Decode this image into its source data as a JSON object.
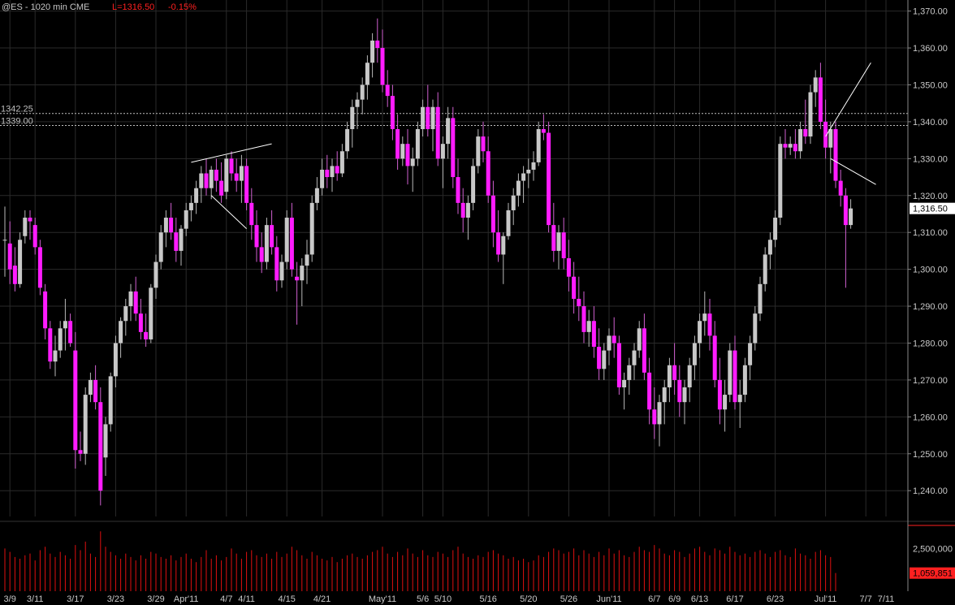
{
  "header": {
    "symbol": "@ES - 1020 min  CME",
    "last": "L=1316.50",
    "change": "-0.15%"
  },
  "colors": {
    "background": "#000000",
    "up": "#c8c8c8",
    "down": "#ff1cff",
    "wick": "#d060d0",
    "grid": "#2a2a2a",
    "axis_text": "#c8c8c8",
    "header_symbol": "#c8c8c8",
    "header_change": "#ff2020",
    "current_price_box": "#ffffff",
    "volume_marker": "#ff2020"
  },
  "chart_data": [
    {
      "type": "candlestick",
      "title": "@ES - 1020 min  CME",
      "ylim": [
        1233,
        1373
      ],
      "y_ticks": [
        "1,240.00",
        "1,250.00",
        "1,260.00",
        "1,270.00",
        "1,280.00",
        "1,290.00",
        "1,300.00",
        "1,310.00",
        "1,320.00",
        "1,330.00",
        "1,340.00",
        "1,350.00",
        "1,360.00",
        "1,370.00"
      ],
      "x_labels": [
        "3/9",
        "3/11",
        "3/17",
        "3/23",
        "3/29",
        "Apr'11",
        "4/7",
        "4/11",
        "4/15",
        "4/21",
        "May'11",
        "5/6",
        "5/10",
        "5/16",
        "5/20",
        "5/26",
        "Jun'11",
        "6/7",
        "6/9",
        "6/13",
        "6/17",
        "6/23",
        "Jul'11",
        "7/7",
        "7/11"
      ],
      "x_label_index": [
        1,
        6,
        14,
        22,
        30,
        36,
        44,
        48,
        56,
        63,
        75,
        83,
        87,
        96,
        104,
        112,
        120,
        129,
        133,
        138,
        145,
        153,
        163,
        171,
        175
      ],
      "reference_lines": [
        {
          "value": 1342.25,
          "label": "1342.25"
        },
        {
          "value": 1339.0,
          "label": "1339.00"
        }
      ],
      "current_price": {
        "value": 1316.5,
        "label": "1,316.50"
      },
      "trendlines": [
        {
          "from": [
            37,
            1329
          ],
          "to": [
            53,
            1334
          ]
        },
        {
          "from": [
            41,
            1320
          ],
          "to": [
            48,
            1311
          ]
        },
        {
          "from": [
            163,
            1336
          ],
          "to": [
            172,
            1356
          ]
        },
        {
          "from": [
            164,
            1330
          ],
          "to": [
            173,
            1323
          ]
        }
      ],
      "candles": [
        [
          1308,
          1317,
          1298,
          1308
        ],
        [
          1307,
          1313,
          1296,
          1300
        ],
        [
          1301,
          1306,
          1294,
          1296
        ],
        [
          1296,
          1310,
          1295,
          1308
        ],
        [
          1309,
          1316,
          1307,
          1314
        ],
        [
          1314,
          1316,
          1308,
          1313
        ],
        [
          1312,
          1314,
          1304,
          1306
        ],
        [
          1306,
          1308,
          1293,
          1295
        ],
        [
          1294,
          1296,
          1281,
          1284
        ],
        [
          1284,
          1286,
          1273,
          1275
        ],
        [
          1275,
          1282,
          1271,
          1278
        ],
        [
          1278,
          1286,
          1276,
          1284
        ],
        [
          1284,
          1292,
          1278,
          1286
        ],
        [
          1286,
          1288,
          1279,
          1280
        ],
        [
          1278,
          1283,
          1246,
          1251
        ],
        [
          1251,
          1256,
          1248,
          1250
        ],
        [
          1250,
          1268,
          1247,
          1266
        ],
        [
          1266,
          1272,
          1264,
          1270
        ],
        [
          1270,
          1274,
          1262,
          1264
        ],
        [
          1264,
          1268,
          1236,
          1240
        ],
        [
          1249,
          1260,
          1244,
          1258
        ],
        [
          1258,
          1272,
          1256,
          1271
        ],
        [
          1271,
          1282,
          1268,
          1280
        ],
        [
          1280,
          1287,
          1276,
          1286
        ],
        [
          1286,
          1292,
          1282,
          1290
        ],
        [
          1290,
          1296,
          1286,
          1294
        ],
        [
          1294,
          1298,
          1286,
          1288
        ],
        [
          1288,
          1292,
          1281,
          1283
        ],
        [
          1283,
          1288,
          1279,
          1281
        ],
        [
          1281,
          1296,
          1280,
          1295
        ],
        [
          1295,
          1304,
          1292,
          1302
        ],
        [
          1302,
          1312,
          1300,
          1310
        ],
        [
          1310,
          1316,
          1306,
          1314
        ],
        [
          1314,
          1318,
          1308,
          1310
        ],
        [
          1310,
          1314,
          1302,
          1305
        ],
        [
          1305,
          1312,
          1301,
          1311
        ],
        [
          1311,
          1318,
          1309,
          1316
        ],
        [
          1316,
          1320,
          1313,
          1318
        ],
        [
          1318,
          1324,
          1315,
          1322
        ],
        [
          1322,
          1328,
          1318,
          1326
        ],
        [
          1326,
          1330,
          1320,
          1322
        ],
        [
          1322,
          1328,
          1319,
          1327
        ],
        [
          1327,
          1330,
          1321,
          1324
        ],
        [
          1324,
          1329,
          1318,
          1320
        ],
        [
          1321,
          1331,
          1319,
          1330
        ],
        [
          1330,
          1332,
          1324,
          1326
        ],
        [
          1326,
          1330,
          1321,
          1324
        ],
        [
          1324,
          1331,
          1318,
          1328
        ],
        [
          1328,
          1330,
          1316,
          1318
        ],
        [
          1318,
          1322,
          1308,
          1312
        ],
        [
          1312,
          1316,
          1302,
          1306
        ],
        [
          1306,
          1310,
          1299,
          1302
        ],
        [
          1302,
          1314,
          1300,
          1312
        ],
        [
          1312,
          1316,
          1304,
          1306
        ],
        [
          1306,
          1309,
          1294,
          1297
        ],
        [
          1297,
          1304,
          1295,
          1302
        ],
        [
          1302,
          1316,
          1300,
          1314
        ],
        [
          1314,
          1318,
          1298,
          1300
        ],
        [
          1298,
          1302,
          1285,
          1297
        ],
        [
          1297,
          1303,
          1290,
          1301
        ],
        [
          1301,
          1308,
          1296,
          1304
        ],
        [
          1304,
          1320,
          1302,
          1318
        ],
        [
          1318,
          1325,
          1316,
          1322
        ],
        [
          1322,
          1330,
          1320,
          1327
        ],
        [
          1327,
          1331,
          1322,
          1325
        ],
        [
          1325,
          1330,
          1321,
          1328
        ],
        [
          1328,
          1332,
          1324,
          1326
        ],
        [
          1326,
          1334,
          1325,
          1332
        ],
        [
          1332,
          1340,
          1330,
          1338
        ],
        [
          1338,
          1346,
          1333,
          1344
        ],
        [
          1344,
          1348,
          1338,
          1346
        ],
        [
          1346,
          1352,
          1342,
          1350
        ],
        [
          1350,
          1358,
          1346,
          1356
        ],
        [
          1356,
          1364,
          1352,
          1362
        ],
        [
          1362,
          1368,
          1356,
          1360
        ],
        [
          1360,
          1365,
          1348,
          1350
        ],
        [
          1350,
          1354,
          1344,
          1347
        ],
        [
          1347,
          1350,
          1335,
          1338
        ],
        [
          1338,
          1342,
          1327,
          1330
        ],
        [
          1330,
          1336,
          1328,
          1334
        ],
        [
          1334,
          1338,
          1323,
          1328
        ],
        [
          1328,
          1333,
          1321,
          1330
        ],
        [
          1330,
          1340,
          1328,
          1338
        ],
        [
          1338,
          1346,
          1336,
          1344
        ],
        [
          1344,
          1350,
          1336,
          1338
        ],
        [
          1338,
          1346,
          1332,
          1344
        ],
        [
          1344,
          1348,
          1328,
          1330
        ],
        [
          1330,
          1336,
          1322,
          1334
        ],
        [
          1334,
          1344,
          1330,
          1341
        ],
        [
          1341,
          1344,
          1322,
          1325
        ],
        [
          1325,
          1330,
          1315,
          1318
        ],
        [
          1318,
          1322,
          1310,
          1314
        ],
        [
          1314,
          1320,
          1308,
          1318
        ],
        [
          1318,
          1330,
          1316,
          1328
        ],
        [
          1328,
          1338,
          1326,
          1336
        ],
        [
          1336,
          1340,
          1329,
          1332
        ],
        [
          1332,
          1336,
          1318,
          1320
        ],
        [
          1320,
          1324,
          1306,
          1310
        ],
        [
          1310,
          1316,
          1302,
          1304
        ],
        [
          1304,
          1310,
          1296,
          1309
        ],
        [
          1309,
          1318,
          1308,
          1316
        ],
        [
          1316,
          1322,
          1312,
          1320
        ],
        [
          1320,
          1326,
          1317,
          1324
        ],
        [
          1324,
          1328,
          1318,
          1326
        ],
        [
          1326,
          1330,
          1322,
          1327
        ],
        [
          1327,
          1332,
          1324,
          1329
        ],
        [
          1329,
          1340,
          1328,
          1338
        ],
        [
          1338,
          1342,
          1335,
          1337
        ],
        [
          1337,
          1340,
          1310,
          1312
        ],
        [
          1312,
          1318,
          1302,
          1305
        ],
        [
          1305,
          1312,
          1300,
          1310
        ],
        [
          1310,
          1314,
          1300,
          1303
        ],
        [
          1303,
          1308,
          1294,
          1298
        ],
        [
          1298,
          1302,
          1288,
          1292
        ],
        [
          1292,
          1298,
          1286,
          1290
        ],
        [
          1290,
          1294,
          1280,
          1283
        ],
        [
          1283,
          1289,
          1279,
          1286
        ],
        [
          1286,
          1290,
          1276,
          1279
        ],
        [
          1279,
          1284,
          1270,
          1273
        ],
        [
          1273,
          1280,
          1270,
          1278
        ],
        [
          1278,
          1284,
          1274,
          1282
        ],
        [
          1282,
          1287,
          1276,
          1280
        ],
        [
          1280,
          1282,
          1266,
          1268
        ],
        [
          1268,
          1272,
          1262,
          1270
        ],
        [
          1270,
          1276,
          1266,
          1274
        ],
        [
          1274,
          1280,
          1270,
          1278
        ],
        [
          1278,
          1286,
          1276,
          1284
        ],
        [
          1284,
          1288,
          1270,
          1272
        ],
        [
          1272,
          1276,
          1258,
          1262
        ],
        [
          1262,
          1268,
          1254,
          1258
        ],
        [
          1258,
          1266,
          1252,
          1264
        ],
        [
          1264,
          1270,
          1258,
          1268
        ],
        [
          1268,
          1276,
          1264,
          1274
        ],
        [
          1274,
          1280,
          1266,
          1270
        ],
        [
          1270,
          1274,
          1260,
          1264
        ],
        [
          1264,
          1270,
          1258,
          1268
        ],
        [
          1268,
          1276,
          1264,
          1274
        ],
        [
          1274,
          1282,
          1270,
          1280
        ],
        [
          1280,
          1288,
          1276,
          1286
        ],
        [
          1286,
          1294,
          1282,
          1288
        ],
        [
          1288,
          1292,
          1278,
          1282
        ],
        [
          1282,
          1286,
          1268,
          1270
        ],
        [
          1270,
          1276,
          1258,
          1262
        ],
        [
          1262,
          1270,
          1256,
          1266
        ],
        [
          1266,
          1280,
          1264,
          1278
        ],
        [
          1278,
          1282,
          1262,
          1264
        ],
        [
          1264,
          1270,
          1257,
          1266
        ],
        [
          1266,
          1276,
          1264,
          1274
        ],
        [
          1274,
          1282,
          1270,
          1280
        ],
        [
          1280,
          1290,
          1278,
          1288
        ],
        [
          1288,
          1298,
          1286,
          1296
        ],
        [
          1296,
          1306,
          1294,
          1304
        ],
        [
          1304,
          1310,
          1300,
          1308
        ],
        [
          1308,
          1316,
          1306,
          1314
        ],
        [
          1314,
          1336,
          1312,
          1334
        ],
        [
          1334,
          1338,
          1330,
          1333
        ],
        [
          1333,
          1336,
          1331,
          1334
        ],
        [
          1334,
          1338,
          1330,
          1332
        ],
        [
          1332,
          1340,
          1330,
          1338
        ],
        [
          1338,
          1346,
          1334,
          1336
        ],
        [
          1336,
          1350,
          1334,
          1348
        ],
        [
          1348,
          1354,
          1344,
          1352
        ],
        [
          1352,
          1356,
          1338,
          1340
        ],
        [
          1340,
          1346,
          1330,
          1333
        ],
        [
          1333,
          1340,
          1326,
          1338
        ],
        [
          1338,
          1340,
          1322,
          1324
        ],
        [
          1324,
          1327,
          1317,
          1320
        ],
        [
          1320,
          1322,
          1295,
          1312
        ],
        [
          1312,
          1319,
          1311,
          1316.5
        ]
      ]
    },
    {
      "type": "bar",
      "title": "",
      "y_ticks": [
        "2,500,000"
      ],
      "current_value": {
        "value": 1059851,
        "label": "1,059,851"
      },
      "ylim": [
        0,
        3800000
      ],
      "values": [
        2500000,
        2300000,
        2000000,
        1900000,
        2100000,
        2200000,
        1800000,
        2400000,
        2600000,
        2200000,
        2000000,
        2300000,
        2100000,
        1900000,
        2700000,
        2400000,
        2900000,
        2200000,
        2000000,
        3500000,
        2600000,
        2300000,
        2100000,
        1900000,
        2200000,
        2000000,
        1800000,
        2100000,
        1900000,
        2300000,
        2200000,
        2000000,
        1900000,
        2100000,
        1800000,
        2000000,
        2200000,
        1900000,
        1700000,
        2000000,
        2400000,
        1900000,
        2100000,
        1800000,
        2000000,
        2500000,
        2200000,
        1900000,
        2300000,
        2400000,
        2100000,
        2000000,
        2200000,
        1900000,
        2300000,
        2000000,
        2200000,
        2600000,
        2400000,
        2100000,
        1900000,
        2300000,
        2100000,
        1900000,
        1800000,
        2000000,
        1700000,
        1900000,
        2100000,
        2200000,
        2000000,
        1900000,
        2100000,
        2300000,
        2400000,
        2600000,
        2200000,
        2000000,
        2300000,
        2100000,
        2500000,
        2200000,
        2000000,
        2400000,
        2100000,
        2000000,
        2300000,
        2200000,
        2000000,
        2400000,
        2600000,
        2200000,
        2000000,
        1900000,
        2100000,
        2000000,
        2300000,
        2400000,
        2200000,
        2100000,
        1900000,
        2000000,
        1800000,
        1900000,
        1700000,
        1800000,
        2100000,
        2000000,
        2300000,
        2500000,
        2400000,
        2200000,
        2300000,
        2500000,
        2100000,
        2400000,
        2200000,
        2000000,
        2300000,
        2100000,
        2500000,
        2200000,
        2400000,
        2100000,
        2000000,
        2300000,
        2600000,
        2400000,
        2300000,
        2700000,
        2500000,
        2200000,
        2100000,
        2400000,
        2300000,
        2000000,
        2200000,
        2500000,
        2600000,
        2300000,
        2100000,
        2500000,
        2400000,
        2200000,
        2600000,
        2300000,
        2100000,
        2200000,
        2000000,
        2300000,
        2400000,
        2200000,
        2000000,
        2300000,
        2400000,
        2100000,
        2000000,
        2500000,
        2200000,
        2100000,
        1900000,
        2300000,
        2400000,
        2100000,
        2000000,
        1059851
      ]
    }
  ]
}
